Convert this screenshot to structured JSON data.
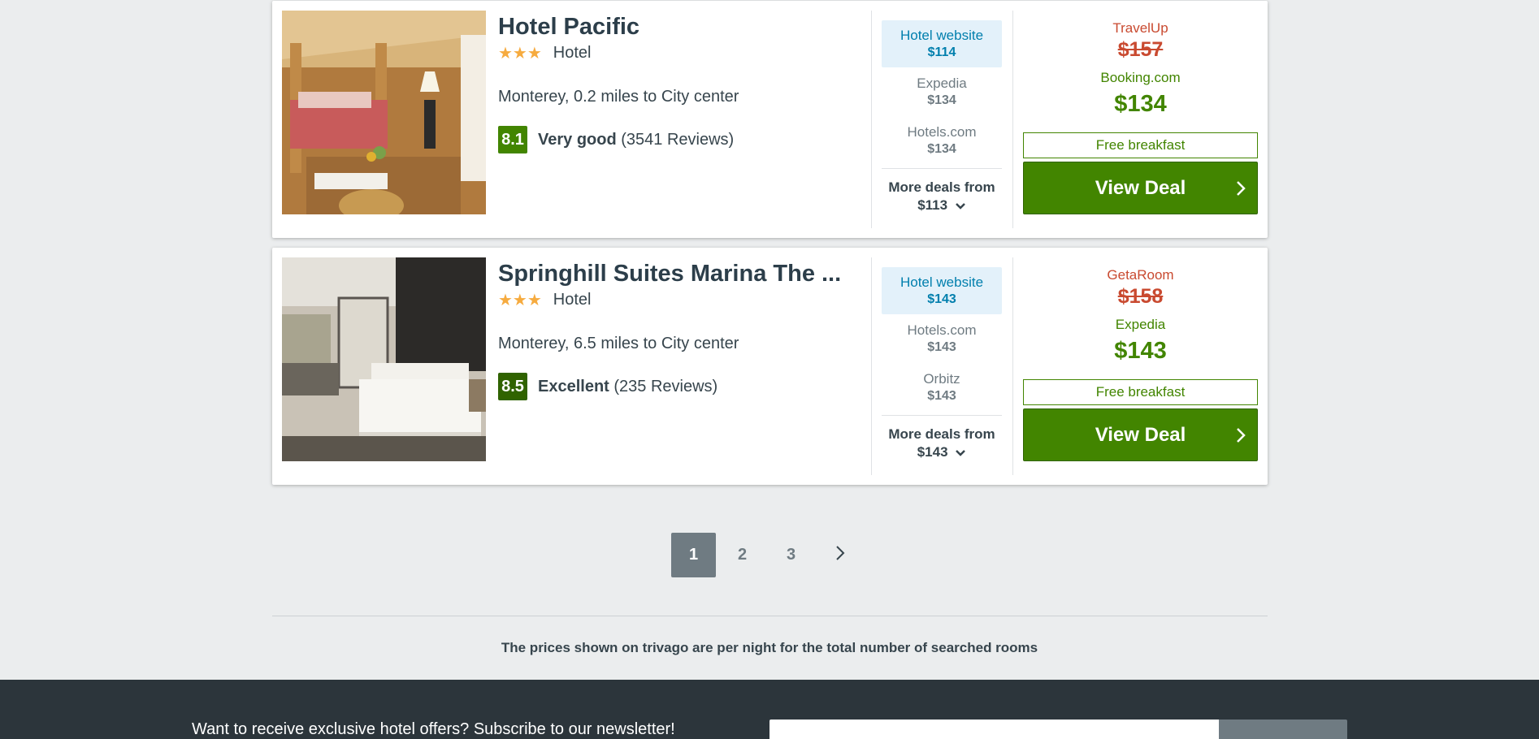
{
  "hotels": [
    {
      "name": "Hotel Pacific",
      "stars": "★★★",
      "type": "Hotel",
      "location": "Monterey, 0.2 miles to City center",
      "rating_score": "8.1",
      "rating_word": "Very good",
      "reviews": "(3541 Reviews)",
      "deal_highlight": {
        "provider": "Hotel website",
        "price": "$114"
      },
      "deals": [
        {
          "provider": "Expedia",
          "price": "$134"
        },
        {
          "provider": "Hotels.com",
          "price": "$134"
        }
      ],
      "more_deals_label": "More deals from",
      "more_deals_price": "$113",
      "crossed_provider": "TravelUp",
      "crossed_price": "$157",
      "best_provider": "Booking.com",
      "best_price": "$134",
      "amenity": "Free breakfast",
      "cta": "View Deal"
    },
    {
      "name": "Springhill Suites Marina The ...",
      "stars": "★★★",
      "type": "Hotel",
      "location": "Monterey, 6.5 miles to City center",
      "rating_score": "8.5",
      "rating_word": "Excellent",
      "reviews": "(235 Reviews)",
      "deal_highlight": {
        "provider": "Hotel website",
        "price": "$143"
      },
      "deals": [
        {
          "provider": "Hotels.com",
          "price": "$143"
        },
        {
          "provider": "Orbitz",
          "price": "$143"
        }
      ],
      "more_deals_label": "More deals from",
      "more_deals_price": "$143",
      "crossed_provider": "GetaRoom",
      "crossed_price": "$158",
      "best_provider": "Expedia",
      "best_price": "$143",
      "amenity": "Free breakfast",
      "cta": "View Deal"
    }
  ],
  "pagination": {
    "pages": [
      "1",
      "2",
      "3"
    ],
    "active": "1",
    "next_icon": "chevron-right-icon"
  },
  "price_note": "The prices shown on trivago are per night for the total number of searched rooms",
  "footer": {
    "newsletter_text": "Want to receive exclusive hotel offers? Subscribe to our newsletter!"
  },
  "colors": {
    "green": "#428500",
    "red": "#c94a30",
    "blue": "#007fad",
    "star": "#f6ab3f",
    "footer_bg": "#2c353b"
  }
}
